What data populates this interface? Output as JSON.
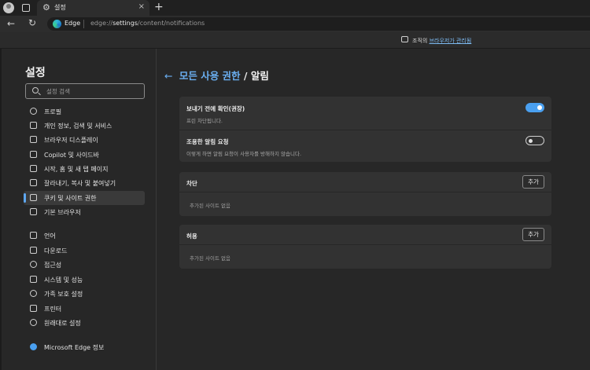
{
  "tab": {
    "title": "설정",
    "close": "×",
    "new_tab": "+"
  },
  "toolbar": {
    "site_label": "Edge",
    "url_prefix": "edge://",
    "url_host": "settings",
    "url_path": "/content/notifications"
  },
  "managed_bar": {
    "text": "조직의",
    "link": "브라우저가 관리됨"
  },
  "sidebar": {
    "title": "설정",
    "search_placeholder": "설정 검색",
    "items": [
      {
        "label": "프로필",
        "icon": "profile-icon"
      },
      {
        "label": "개인 정보, 검색 및 서비스",
        "icon": "lock-icon"
      },
      {
        "label": "브라우저 디스플레이",
        "icon": "display-icon"
      },
      {
        "label": "Copilot 및 사이드바",
        "icon": "sidebar-icon"
      },
      {
        "label": "시작, 홈 및 새 탭 페이지",
        "icon": "home-icon"
      },
      {
        "label": "잘라내기, 복사 및 붙여넣기",
        "icon": "clipboard-icon"
      },
      {
        "label": "쿠키 및 사이트 권한",
        "icon": "cookie-icon",
        "active": true
      },
      {
        "label": "기본 브라우저",
        "icon": "browser-icon"
      },
      {
        "label": "언어",
        "icon": "language-icon"
      },
      {
        "label": "다운로드",
        "icon": "download-icon"
      },
      {
        "label": "접근성",
        "icon": "accessibility-icon"
      },
      {
        "label": "시스템 및 성능",
        "icon": "system-icon"
      },
      {
        "label": "가족 보호 설정",
        "icon": "family-icon"
      },
      {
        "label": "프린터",
        "icon": "printer-icon"
      },
      {
        "label": "원래대로 설정",
        "icon": "reset-icon"
      },
      {
        "label": "Microsoft Edge 정보",
        "icon": "edge-icon"
      }
    ]
  },
  "main": {
    "back_arrow": "←",
    "breadcrumb_parent": "모든 사용 권한",
    "breadcrumb_sep": "/",
    "title": "알림",
    "ask_before_sending": {
      "title": "보내기 전에 확인(권장)",
      "subtitle": "프린 차단됩니다.",
      "enabled": true
    },
    "quiet_requests": {
      "title": "조용한 알림 요청",
      "subtitle": "이렇게 하면 알림 요청이 사용자를 방해하지 않습니다.",
      "enabled": false
    },
    "block": {
      "title": "차단",
      "add_label": "추가",
      "empty_text": "추가된 사이트 없음"
    },
    "allow": {
      "title": "허용",
      "add_label": "추가",
      "empty_text": "추가된 사이트 없음"
    }
  },
  "colors": {
    "accent": "#4aa0f0",
    "link": "#6aaef0",
    "background": "#272727",
    "card": "#323232"
  }
}
